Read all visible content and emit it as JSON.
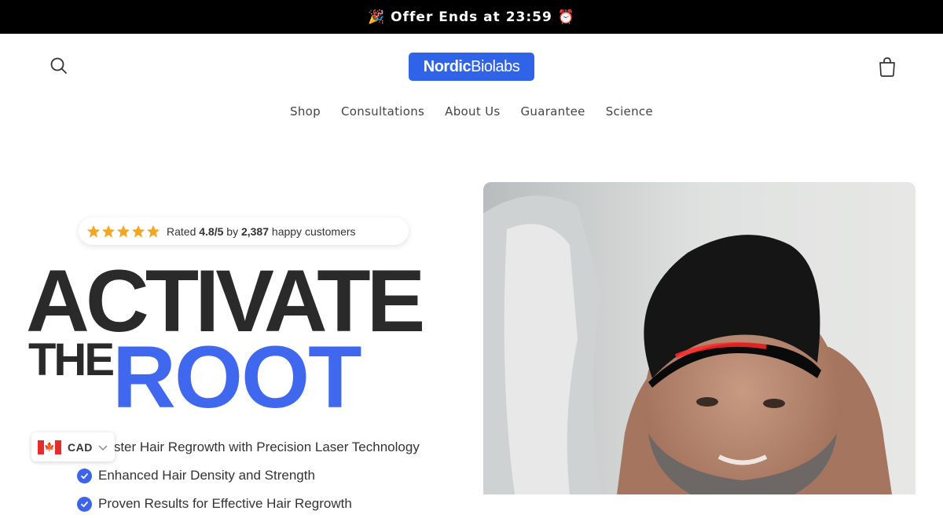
{
  "announcement": {
    "text": "🎉 Offer Ends at 23:59 ⏰"
  },
  "header": {
    "logo_part1": "Nordic",
    "logo_part2": "Biolabs",
    "nav": [
      {
        "label": "Shop"
      },
      {
        "label": "Consultations"
      },
      {
        "label": "About Us"
      },
      {
        "label": "Guarantee"
      },
      {
        "label": "Science"
      }
    ]
  },
  "hero": {
    "rating": {
      "prefix": "Rated",
      "score": "4.8/5",
      "by": "by",
      "count": "2,387",
      "suffix": "happy customers",
      "stars": 5
    },
    "headline_line1": "ACTIVATE",
    "headline_the": "THE",
    "headline_root": "ROOT",
    "benefits": [
      "Faster Hair Regrowth with Precision Laser Technology",
      "Enhanced Hair Density and Strength",
      "Proven Results for Effective Hair Regrowth"
    ],
    "image_icon": "man-wearing-laser-cap-photo"
  },
  "currency_selector": {
    "code": "CAD",
    "flag_icon": "canada-flag-icon"
  },
  "colors": {
    "accent": "#4068ee",
    "logo_bg": "#2f63e8",
    "star": "#f5a623",
    "announcement_bg": "#000000"
  }
}
